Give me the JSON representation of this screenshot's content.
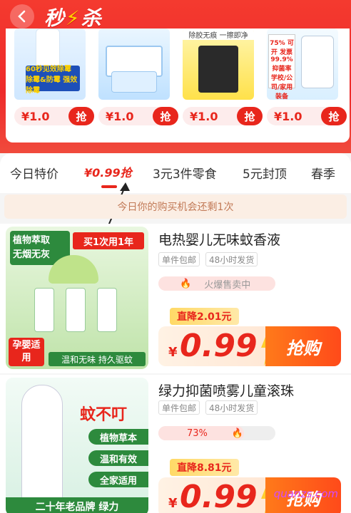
{
  "header": {
    "title": "秒杀",
    "title_prefix": "秒",
    "title_suffix": "杀"
  },
  "flash_products": [
    {
      "price": "¥1.0",
      "grab": "抢",
      "caption": "60秒见效除霉 除霉&防霉 强效除霉"
    },
    {
      "price": "¥1.0",
      "grab": "抢",
      "caption": ""
    },
    {
      "price": "¥1.0",
      "grab": "抢",
      "caption": "除胶无痕 一擦即净"
    },
    {
      "price": "¥1.0",
      "grab": "抢",
      "caption": "75% 可开 发票 99.9% 抑菌率 学校/公司/家用装备"
    }
  ],
  "tabs": [
    "今日特价",
    "0.99抢",
    "3元3件零食",
    "5元封顶",
    "春季"
  ],
  "notice": "今日你的购买机会还剩1次",
  "items": [
    {
      "title": "电热婴儿无味蚊香液",
      "tags": [
        "单件包邮",
        "48小时发货"
      ],
      "status": "火爆售卖中",
      "drop": "直降2.01元",
      "yen": "¥",
      "price": "0.99",
      "buy": "抢购",
      "img_text": {
        "a": "植物萃取",
        "b": "无烟无灰",
        "c": "买1次用1年",
        "d": "孕婴适用",
        "e": "温和无味 持久驱蚊"
      }
    },
    {
      "title": "绿力抑菌喷雾儿童滚珠",
      "tags": [
        "单件包邮",
        "48小时发货"
      ],
      "status": "73%",
      "drop": "直降8.81元",
      "yen": "¥",
      "price": "0.99",
      "buy": "抢购",
      "img_text": {
        "a": "蚊不叮",
        "b": "植物草本",
        "c": "温和有效",
        "d": "全家适用",
        "e": "二十年老品牌 绿力"
      }
    }
  ],
  "watermark": "quanzs.com",
  "colors": {
    "brand_red": "#e8261c",
    "orange": "#ff6a1a"
  }
}
